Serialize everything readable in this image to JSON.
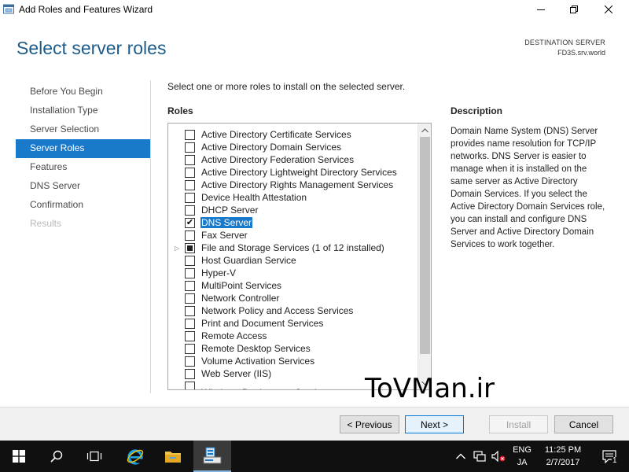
{
  "window": {
    "title": "Add Roles and Features Wizard",
    "icon": "server-manager-icon"
  },
  "header": {
    "title": "Select server roles",
    "destination_label": "DESTINATION SERVER",
    "destination_server": "FD3S.srv.world"
  },
  "nav": [
    {
      "label": "Before You Begin",
      "state": "normal"
    },
    {
      "label": "Installation Type",
      "state": "normal"
    },
    {
      "label": "Server Selection",
      "state": "normal"
    },
    {
      "label": "Server Roles",
      "state": "active"
    },
    {
      "label": "Features",
      "state": "normal"
    },
    {
      "label": "DNS Server",
      "state": "normal"
    },
    {
      "label": "Confirmation",
      "state": "normal"
    },
    {
      "label": "Results",
      "state": "disabled"
    }
  ],
  "main": {
    "instruction": "Select one or more roles to install on the selected server.",
    "roles_heading": "Roles",
    "description_heading": "Description",
    "description": "Domain Name System (DNS) Server provides name resolution for TCP/IP networks. DNS Server is easier to manage when it is installed on the same server as Active Directory Domain Services. If you select the Active Directory Domain Services role, you can install and configure DNS Server and Active Directory Domain Services to work together."
  },
  "roles": [
    {
      "label": "Active Directory Certificate Services",
      "checked": false
    },
    {
      "label": "Active Directory Domain Services",
      "checked": false
    },
    {
      "label": "Active Directory Federation Services",
      "checked": false
    },
    {
      "label": "Active Directory Lightweight Directory Services",
      "checked": false
    },
    {
      "label": "Active Directory Rights Management Services",
      "checked": false
    },
    {
      "label": "Device Health Attestation",
      "checked": false
    },
    {
      "label": "DHCP Server",
      "checked": false
    },
    {
      "label": "DNS Server",
      "checked": true,
      "selected": true
    },
    {
      "label": "Fax Server",
      "checked": false
    },
    {
      "label": "File and Storage Services (1 of 12 installed)",
      "checked": "partial",
      "expandable": true
    },
    {
      "label": "Host Guardian Service",
      "checked": false
    },
    {
      "label": "Hyper-V",
      "checked": false
    },
    {
      "label": "MultiPoint Services",
      "checked": false
    },
    {
      "label": "Network Controller",
      "checked": false
    },
    {
      "label": "Network Policy and Access Services",
      "checked": false
    },
    {
      "label": "Print and Document Services",
      "checked": false
    },
    {
      "label": "Remote Access",
      "checked": false
    },
    {
      "label": "Remote Desktop Services",
      "checked": false
    },
    {
      "label": "Volume Activation Services",
      "checked": false
    },
    {
      "label": "Web Server (IIS)",
      "checked": false
    },
    {
      "label": "Windows Deployment Services",
      "checked": false
    }
  ],
  "watermark": "ToVMan.ir",
  "footer": {
    "previous_label": "< Previous",
    "next_label": "Next >",
    "install_label": "Install",
    "cancel_label": "Cancel"
  },
  "taskbar": {
    "language": "ENG",
    "layout": "JA",
    "time": "11:25 PM",
    "date": "2/7/2017",
    "notification_count": "1"
  }
}
